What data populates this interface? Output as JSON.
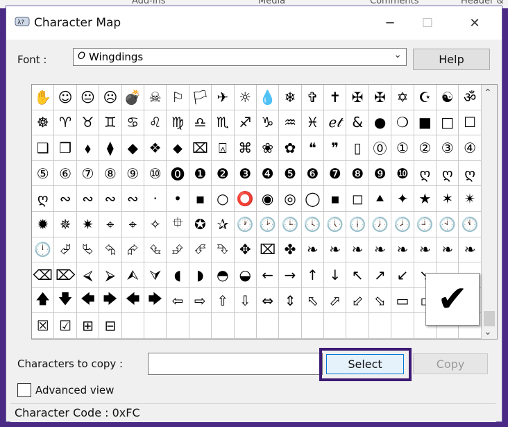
{
  "backdrop": {
    "tabs": [
      "Add-ins",
      "Media",
      "Comments",
      "Header &"
    ]
  },
  "window": {
    "title": "Character Map",
    "minimize_icon": "─",
    "maximize_icon": "☐",
    "close_icon": "✕"
  },
  "font": {
    "label": "Font :",
    "icon_glyph": "O",
    "value": "Wingdings",
    "dropdown_icon": "⌄",
    "help_label": "Help"
  },
  "grid": {
    "cells": [
      "✋",
      "☺",
      "😐",
      "☹",
      "💣",
      "☠",
      "⚐",
      "🏳",
      "✈",
      "☼",
      "💧",
      "❄",
      "✞",
      "✝",
      "✠",
      "✠",
      "✡",
      "☪",
      "☯",
      "ॐ",
      "☸",
      "♈",
      "♉",
      "♊",
      "♋",
      "♌",
      "♍",
      "♎",
      "♏",
      "♐",
      "♑",
      "♒",
      "♓",
      "ℯ𝓉",
      "&",
      "●",
      "❍",
      "■",
      "□",
      "☐",
      "❑",
      "❒",
      "⬧",
      "⧫",
      "◆",
      "❖",
      "⬥",
      "⌧",
      "⍓",
      "⌘",
      "❀",
      "✿",
      "❝",
      "❞",
      "▯",
      "⓪",
      "①",
      "②",
      "③",
      "④",
      "⑤",
      "⑥",
      "⑦",
      "⑧",
      "⑨",
      "⑩",
      "⓿",
      "❶",
      "❷",
      "❸",
      "❹",
      "❺",
      "❻",
      "❼",
      "❽",
      "❾",
      "❿",
      "ღ",
      "ღ",
      "ღ",
      "ღ",
      "∾",
      "∾",
      "∾",
      "∾",
      "·",
      "•",
      "▪",
      "○",
      "⭕",
      "◉",
      "◎",
      "◯",
      "▪",
      "◻",
      "⯅",
      "✦",
      "★",
      "✶",
      "✴",
      "✹",
      "✵",
      "✷",
      "⌖",
      "⌖",
      "✧",
      "⯐",
      "✪",
      "✰",
      "🕐",
      "🕑",
      "🕒",
      "🕓",
      "🕔",
      "🕕",
      "🕖",
      "🕗",
      "🕘",
      "🕙",
      "🕚",
      "🕛",
      "⮰",
      "⮱",
      "⮲",
      "⮳",
      "⮴",
      "⮵",
      "⮶",
      "⮷",
      "✥",
      "⌧",
      "✤",
      "❧",
      "❧",
      "❧",
      "❧",
      "❧",
      "❧",
      "❧",
      "❧",
      "⌫",
      "⌦",
      "⮘",
      "⮚",
      "⮙",
      "⮛",
      "◖",
      "◗",
      "◓",
      "◒",
      "←",
      "→",
      "↑",
      "↓",
      "↖",
      "↗",
      "↙",
      "↘",
      "⭠",
      "⭢",
      "🡅",
      "🡇",
      "🡄",
      "🡆",
      "🡄",
      "🡆",
      "⇦",
      "⇨",
      "⇧",
      "⇩",
      "⇔",
      "⇕",
      "⬁",
      "⬀",
      "⬃",
      "⬂",
      "▭",
      "▫",
      "✗",
      "✔",
      "☒",
      "☑",
      "⊞",
      "⊟",
      "",
      "",
      "",
      "",
      "",
      "",
      "",
      "",
      "",
      "",
      "",
      "",
      "",
      "",
      "",
      ""
    ],
    "scroll_up_icon": "⌃",
    "scroll_down_icon": "⌄",
    "zoom_char": "✔"
  },
  "copy": {
    "label": "Characters to copy :",
    "value": "",
    "select_label": "Select",
    "copy_label": "Copy"
  },
  "advanced": {
    "label": "Advanced view",
    "checked": false
  },
  "status": {
    "text": "Character Code : 0xFC"
  }
}
